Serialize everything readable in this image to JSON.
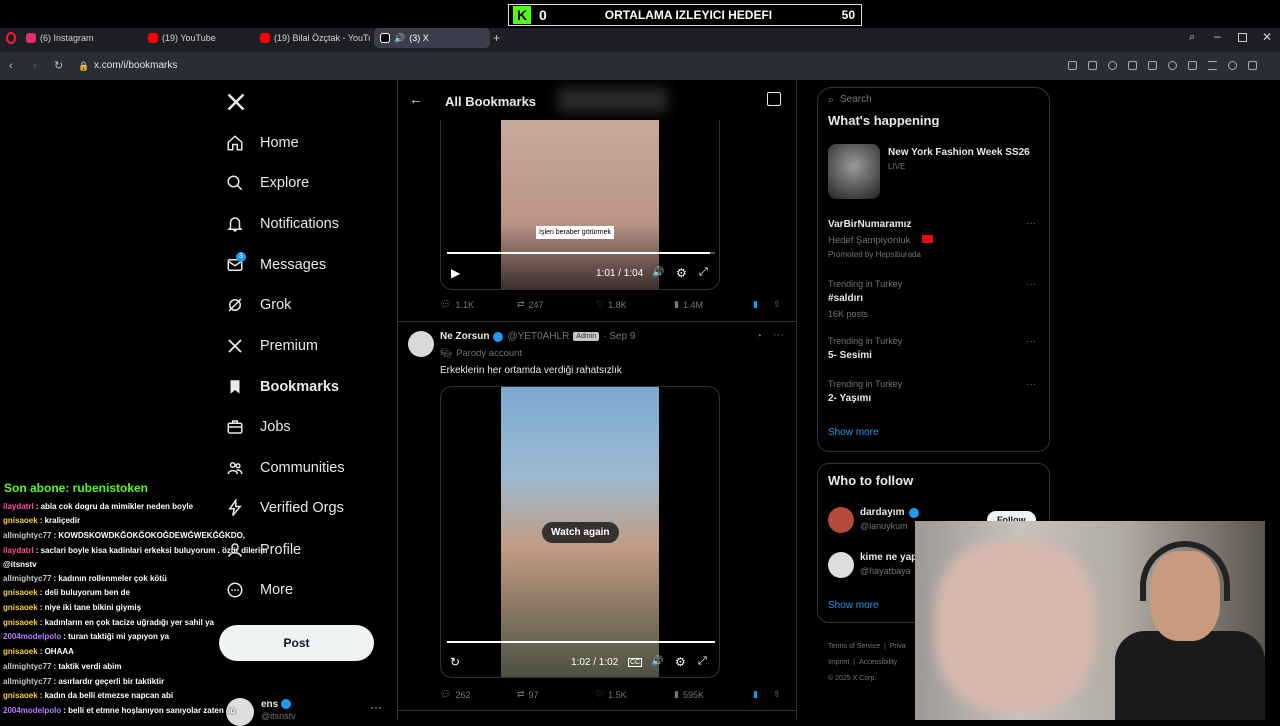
{
  "overlay": {
    "goal_count": "0",
    "goal_label": "ORTALAMA IZLEYICI HEDEFI",
    "goal_target": "50",
    "sub_banner": "Son abone: rubenistoken"
  },
  "browser": {
    "tabs": [
      {
        "label": "(6) Instagram",
        "color": "#e1306c"
      },
      {
        "label": "(19) YouTube",
        "color": "#ff0000"
      },
      {
        "label": "(19) Bilal Özçtak - YouTub",
        "color": "#ff0000"
      },
      {
        "label": "(3) X",
        "color": "#ffffff"
      }
    ],
    "url": "x.com/i/bookmarks"
  },
  "nav": {
    "items": [
      {
        "label": "Home",
        "icon": "home-icon"
      },
      {
        "label": "Explore",
        "icon": "search-icon"
      },
      {
        "label": "Notifications",
        "icon": "bell-icon"
      },
      {
        "label": "Messages",
        "icon": "mail-icon",
        "badge": "3"
      },
      {
        "label": "Grok",
        "icon": "grok-icon"
      },
      {
        "label": "Premium",
        "icon": "x-logo-icon"
      },
      {
        "label": "Bookmarks",
        "icon": "bookmark-icon"
      },
      {
        "label": "Jobs",
        "icon": "briefcase-icon"
      },
      {
        "label": "Communities",
        "icon": "people-icon"
      },
      {
        "label": "Verified Orgs",
        "icon": "lightning-icon"
      },
      {
        "label": "Profile",
        "icon": "person-icon"
      },
      {
        "label": "More",
        "icon": "more-circle-icon"
      }
    ],
    "post_label": "Post",
    "account_name": "ens",
    "account_handle": "@itsnstv"
  },
  "header": {
    "title": "All Bookmarks"
  },
  "tweet1": {
    "caption": "İşleri beraber götürmek",
    "time": "1:01 / 1:04",
    "replies": "1.1K",
    "reposts": "247",
    "likes": "1.8K",
    "views": "1.4M"
  },
  "tweet2": {
    "name": "Ne Zorsun",
    "handle": "@YET0AHLR",
    "badge": "Admin",
    "date": "· Sep 9",
    "sub": "Parody account",
    "text": "Erkeklerin her ortamda verdiği rahatsızlık",
    "watch_again": "Watch again",
    "time": "1:02 / 1:02",
    "replies": "262",
    "reposts": "97",
    "likes": "1.5K",
    "views": "595K"
  },
  "right": {
    "search_placeholder": "Search",
    "happening_title": "What's happening",
    "event_title": "New York Fashion Week SS26",
    "event_live": "LIVE",
    "promo_name": "VarBirNumaramız",
    "promo_sub": "Hedef Şampiyonluk",
    "promo_by": "Promoted by Hepsiburada",
    "trends": [
      {
        "meta": "Trending in Turkey",
        "title": "#saldırı",
        "count": "16K posts"
      },
      {
        "meta": "Trending in Turkey",
        "title": "5- Sesimi",
        "count": ""
      },
      {
        "meta": "Trending in Turkey",
        "title": "2- Yaşımı",
        "count": ""
      }
    ],
    "show_more": "Show more",
    "who_title": "Who to follow",
    "follow": [
      {
        "name": "dardayım",
        "handle": "@lanuykum"
      },
      {
        "name": "kime ne yap",
        "handle": "@hayatbaya"
      }
    ],
    "follow_btn": "Follow",
    "show_more2": "Show more",
    "footer1": "Terms of Service",
    "footer2": "Priva",
    "footer3": "Imprint",
    "footer4": "Accessibility",
    "footer5": "© 2025 X Corp."
  },
  "chat": [
    {
      "user": "ilaydatrl",
      "color": "#ff4da6",
      "msg": ": abla cok dogru da mimikler neden boyle"
    },
    {
      "user": "gnisaoek",
      "color": "#f5d142",
      "msg": ": kraliçedir"
    },
    {
      "user": "allmightyc77",
      "color": "#c6c6c6",
      "msg": ": KOWDSKOWDKĞOKĞOKOĞDEWĞWEKĞĞKDO,"
    },
    {
      "user": "ilaydatrl",
      "color": "#ff4da6",
      "msg": ": saclari boyle kisa kadinlari erkeksi buluyorum . özür dilerim"
    },
    {
      "user": "",
      "color": "#ffffff",
      "msg": "@itsnstv"
    },
    {
      "user": "allmightyc77",
      "color": "#c6c6c6",
      "msg": ": kadının rollenmeler çok kötü"
    },
    {
      "user": "gnisaoek",
      "color": "#f5d142",
      "msg": ": deli buluyorum ben de"
    },
    {
      "user": "gnisaoek",
      "color": "#f5d142",
      "msg": ": niye iki tane bikini giymiş"
    },
    {
      "user": "gnisaoek",
      "color": "#f5d142",
      "msg": ": kadınların en çok tacize uğradığı yer sahil ya"
    },
    {
      "user": "2004modelpolo",
      "color": "#b57bff",
      "msg": ": turan taktiği mi yapıyon ya"
    },
    {
      "user": "gnisaoek",
      "color": "#f5d142",
      "msg": ": OHAAA"
    },
    {
      "user": "allmightyc77",
      "color": "#c6c6c6",
      "msg": ": taktik verdi abim"
    },
    {
      "user": "allmightyc77",
      "color": "#c6c6c6",
      "msg": ": asırlardır geçerli bir taktiktir"
    },
    {
      "user": "gnisaoek",
      "color": "#f5d142",
      "msg": ": kadın da belli etmezse napcan abi"
    },
    {
      "user": "2004modelpolo",
      "color": "#b57bff",
      "msg": ": belli et etmne hoşlanıyon sanıyolar zaten aq"
    }
  ],
  "colors": {
    "accent": "#1d9bf0",
    "bg": "#000000",
    "border": "#2f3336",
    "kick": "#53fc18"
  }
}
